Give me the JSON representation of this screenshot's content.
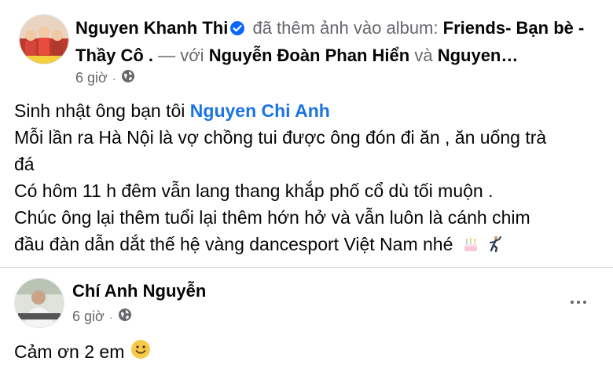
{
  "post": {
    "author": "Nguyen Khanh Thi",
    "action_text": "đã thêm ảnh vào album:",
    "album_name": "Friends- Bạn bè - Thầy Cô .",
    "with_text": "— với",
    "tagged_1": "Nguyễn Đoàn Phan Hiển",
    "and_text": "và",
    "tagged_2": "Nguyen…",
    "time": "6 giờ",
    "privacy_icon": "globe-icon",
    "lines": {
      "l1_prefix": "Sinh nhật ông bạn tôi",
      "l1_mention": "Nguyen Chi Anh",
      "l2": "Mỗi lần ra Hà Nội là vợ chồng tui được ông đón đi ăn , ăn uống trà",
      "l3": "đá",
      "l4": "Có hôm 11 h đêm vẫn lang thang khắp phố cổ dù tối muộn .",
      "l5": "Chúc ông lại thêm tuổi lại thêm hớn hở và vẫn luôn là cánh chim",
      "l6": "đầu đàn dẫn dắt thế hệ vàng dancesport Việt Nam nhé"
    },
    "emojis": [
      "birthday-cake-icon",
      "dancer-icon"
    ]
  },
  "comment": {
    "author": "Chí Anh Nguyễn",
    "time": "6 giờ",
    "privacy_icon": "globe-icon",
    "text": "Cảm ơn 2 em",
    "emoji": "smiley-icon",
    "menu_icon": "more-options-icon"
  },
  "colors": {
    "link_blue": "#1b74e4",
    "secondary_text": "#65676b",
    "verified_blue": "#0866ff"
  }
}
